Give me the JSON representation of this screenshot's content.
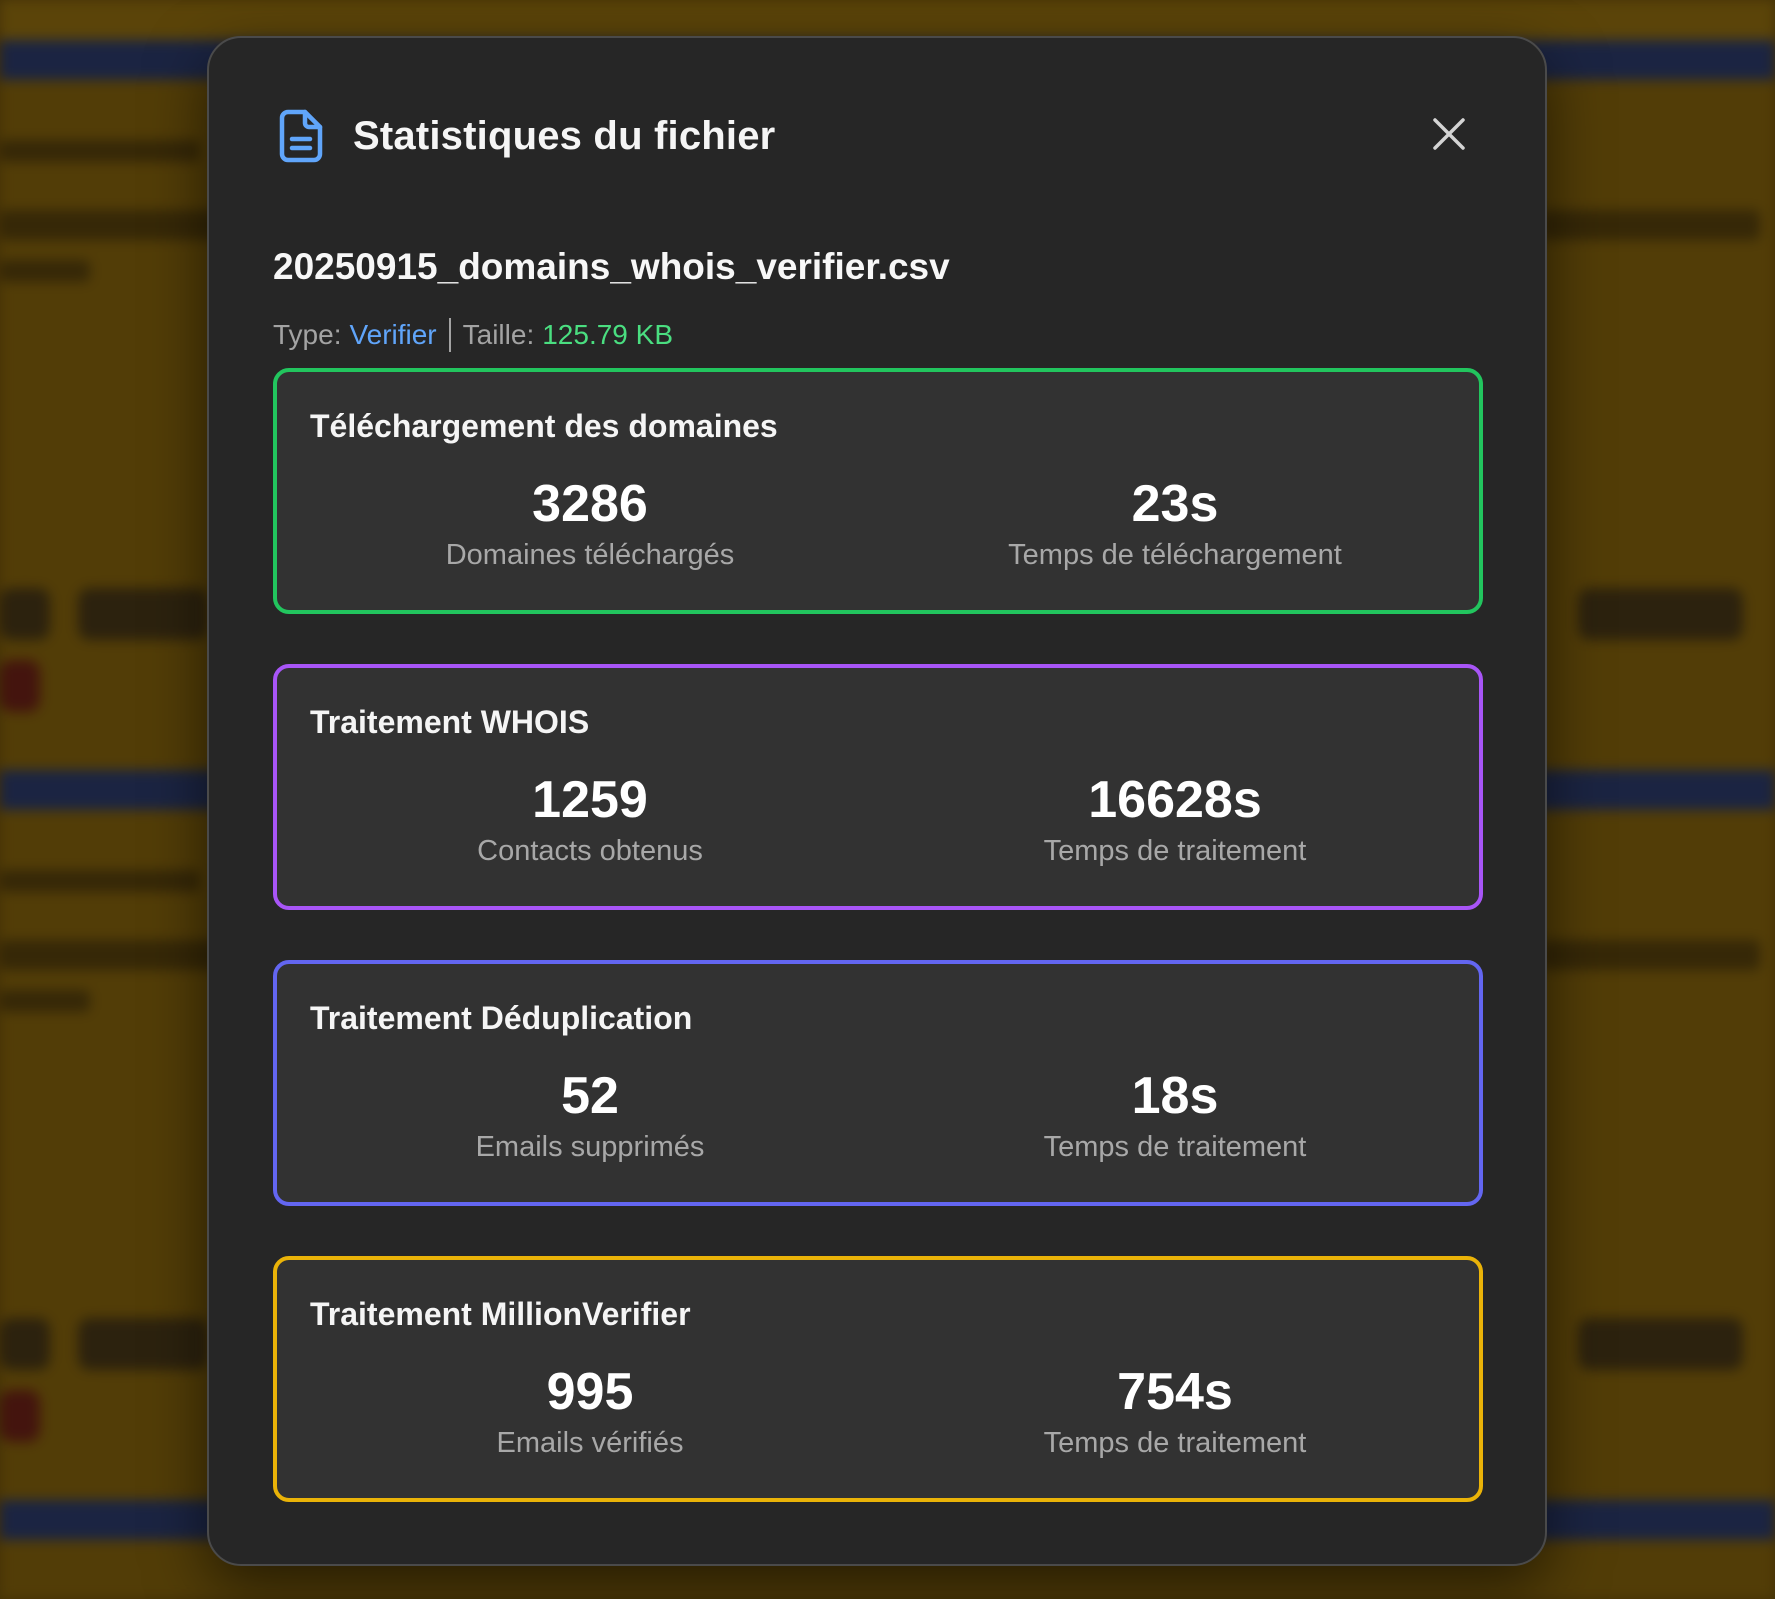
{
  "modal": {
    "title": "Statistiques du fichier",
    "icon": "file-document-icon",
    "close_icon": "close-icon",
    "file_name": "20250915_domains_whois_verifier.csv",
    "meta": {
      "type_label": "Type:",
      "type_value": "Verifier",
      "size_label": "Taille:",
      "size_value": "125.79 KB"
    }
  },
  "colors": {
    "type_value": "#60a5fa",
    "size_value": "#4ade80",
    "download_border": "#22c55e",
    "whois_border": "#a855f7",
    "dedup_border": "#6366f1",
    "verifier_border": "#eab308"
  },
  "sections": [
    {
      "title": "Téléchargement des domaines",
      "left": {
        "value": "3286",
        "label": "Domaines téléchargés"
      },
      "right": {
        "value": "23s",
        "label": "Temps de téléchargement"
      }
    },
    {
      "title": "Traitement WHOIS",
      "left": {
        "value": "1259",
        "label": "Contacts obtenus"
      },
      "right": {
        "value": "16628s",
        "label": "Temps de traitement"
      }
    },
    {
      "title": "Traitement Déduplication",
      "left": {
        "value": "52",
        "label": "Emails supprimés"
      },
      "right": {
        "value": "18s",
        "label": "Temps de traitement"
      }
    },
    {
      "title": "Traitement MillionVerifier",
      "left": {
        "value": "995",
        "label": "Emails vérifiés"
      },
      "right": {
        "value": "754s",
        "label": "Temps de traitement"
      }
    }
  ]
}
